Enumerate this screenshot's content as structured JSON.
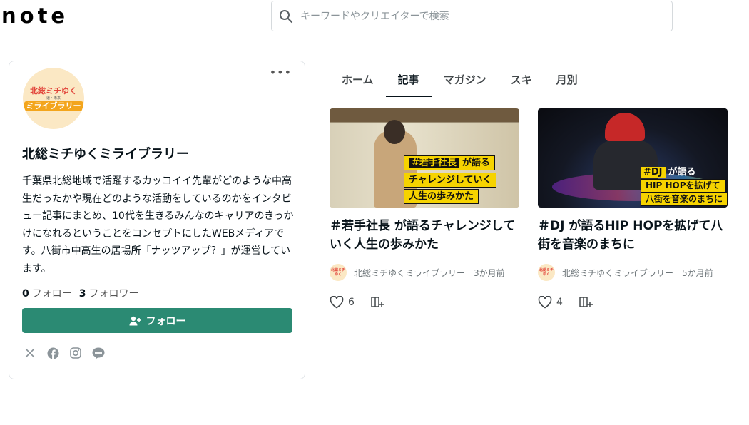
{
  "header": {
    "logo": "note",
    "search_placeholder": "キーワードやクリエイターで検索"
  },
  "profile": {
    "avatar_text": {
      "line1": "北総ミチゆく",
      "line2": "道・未来",
      "line3": "ミライブラリー"
    },
    "more_label": "•••",
    "name": "北総ミチゆくミライブラリー",
    "description": "千葉県北総地域で活躍するカッコイイ先輩がどのような中高生だったかや現在どのような活動をしているのかをインタビュー記事にまとめ、10代を生きるみんなのキャリアのきっかけになれるということをコンセプトにしたWEBメディアです。八街市中高生の居場所「ナッツアップ？」が運営しています。",
    "following_count": "0",
    "following_label": "フォロー",
    "follower_count": "3",
    "follower_label": "フォロワー",
    "follow_button_label": "フォロー",
    "social_icons": [
      "x-icon",
      "facebook-icon",
      "instagram-icon",
      "line-icon"
    ]
  },
  "tabs": [
    {
      "label": "ホーム",
      "active": false
    },
    {
      "label": "記事",
      "active": true
    },
    {
      "label": "マガジン",
      "active": false
    },
    {
      "label": "スキ",
      "active": false
    },
    {
      "label": "月別",
      "active": false
    }
  ],
  "articles": [
    {
      "thumb_lines": [
        "#若手社長",
        "が語る",
        "チャレンジしていく",
        "人生の歩みかた"
      ],
      "title": "＃若手社長 が語るチャレンジしていく人生の歩みかた",
      "author": "北総ミチゆくミライブラリー",
      "time": "3か月前",
      "likes": "6"
    },
    {
      "thumb_lines": [
        "#DJ",
        "が語る",
        "HIP HOPを拡げて",
        "八街を音楽のまちに"
      ],
      "title": "＃DJ が語るHIP HOPを拡げて八街を音楽のまちに",
      "author": "北総ミチゆくミライブラリー",
      "time": "5か月前",
      "likes": "4"
    }
  ],
  "colors": {
    "follow_button": "#2b8a73",
    "text_primary": "#08131a",
    "thumb_label": "#f6d300"
  }
}
